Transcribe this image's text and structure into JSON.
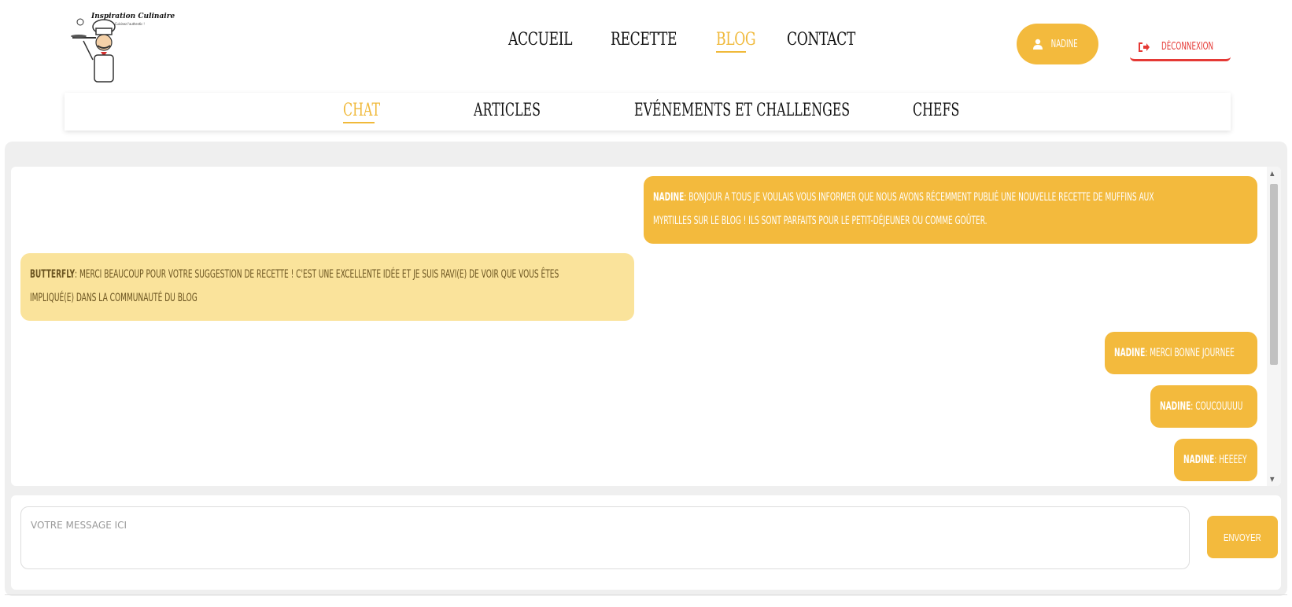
{
  "brand": {
    "title": "Inspiration Culinaire",
    "subtitle": "Cuisinez l'authentic !"
  },
  "main_nav": [
    {
      "label": "Accueil",
      "active": false
    },
    {
      "label": "Recette",
      "active": false
    },
    {
      "label": "Blog",
      "active": true
    },
    {
      "label": "Contact",
      "active": false
    }
  ],
  "user": {
    "name": "Nadine",
    "icon": "user-icon"
  },
  "logout": {
    "label": "Déconnexion",
    "icon": "sign-out-icon"
  },
  "sub_nav": [
    {
      "label": "Chat",
      "active": true
    },
    {
      "label": "Articles",
      "active": false
    },
    {
      "label": "Evénements et challenges",
      "active": false
    },
    {
      "label": "Chefs",
      "active": false
    }
  ],
  "messages": [
    {
      "author": "Nadine",
      "mine": true,
      "lines": [
        "Bonjour a tous Je voulais vous informer que nous avons récemment publié une nouvelle recette de muffins aux",
        "myrtilles sur le blog ! Ils sont parfaits pour le petit-déjeuner ou comme goûter."
      ]
    },
    {
      "author": "Butterfly",
      "mine": false,
      "lines": [
        "Merci beaucoup pour votre suggestion de recette ! C'est une excellente idée et je suis ravi(e) de voir que vous êtes",
        "impliqué(e) dans la communauté du blog"
      ]
    },
    {
      "author": "Nadine",
      "mine": true,
      "lines": [
        "merci bonne journee"
      ]
    },
    {
      "author": "Nadine",
      "mine": true,
      "lines": [
        "coucouuuu"
      ]
    },
    {
      "author": "Nadine",
      "mine": true,
      "lines": [
        "heeeey"
      ]
    }
  ],
  "composer": {
    "placeholder": "Votre message ici",
    "send_label": "Envoyer"
  },
  "colors": {
    "accent": "#f3ba3d",
    "other_bubble": "#fae39b",
    "logout": "#e53935"
  }
}
